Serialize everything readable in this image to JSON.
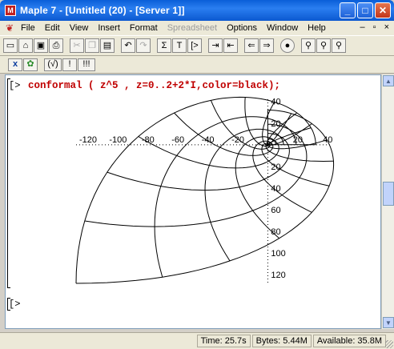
{
  "window": {
    "title": "Maple 7 - [Untitled (20) - [Server 1]]"
  },
  "menu": {
    "items": [
      "File",
      "Edit",
      "View",
      "Insert",
      "Format",
      "Spreadsheet",
      "Options",
      "Window",
      "Help"
    ],
    "disabled": [
      "Spreadsheet"
    ]
  },
  "toolbar": {
    "new": "🗋",
    "open": "📂",
    "save": "💾",
    "print": "⎙",
    "cut": "✂",
    "copy": "⎘",
    "paste": "📋",
    "undo": "↶",
    "redo": "↷",
    "sigma": "Σ",
    "text": "T",
    "prompt": "[>",
    "indent": "⇥",
    "outdent": "⇤",
    "back": "⇐",
    "forward": "⇒",
    "stop": "●",
    "zoom_in": "🔍",
    "zoom_out": "🔎",
    "restart": "↺"
  },
  "toolbar2": {
    "maple_input": "x",
    "leaf": "🍁",
    "sqrt": "(√)",
    "exclaim": "!",
    "triple": "!!!"
  },
  "worksheet": {
    "prompt": "[>",
    "command": "conformal ( z^5 , z=0..2+2*I,color=black);",
    "empty_prompt": "[>"
  },
  "chart_data": {
    "type": "line",
    "description_none": "",
    "x_ticks": [
      -120,
      -100,
      -80,
      -60,
      -40,
      -20,
      20,
      40
    ],
    "x_tick_labels": [
      "-120",
      "-100",
      "-80",
      "-60",
      "-40",
      "-20",
      "20",
      "40"
    ],
    "y_ticks": [
      40,
      20,
      -20,
      -40,
      -60,
      -80,
      -100,
      -120
    ],
    "y_tick_labels": [
      "40",
      "20",
      "20",
      "40",
      "60",
      "80",
      "100",
      "120"
    ],
    "xlim": [
      -128,
      42
    ],
    "ylim": [
      -128,
      42
    ],
    "color": "#000000",
    "grid": {
      "u_range": [
        0,
        2
      ],
      "v_range": [
        0,
        2
      ],
      "lines_each_direction": 11
    }
  },
  "status": {
    "time": "Time: 25.7s",
    "bytes": "Bytes: 5.44M",
    "available": "Available: 35.8M"
  }
}
